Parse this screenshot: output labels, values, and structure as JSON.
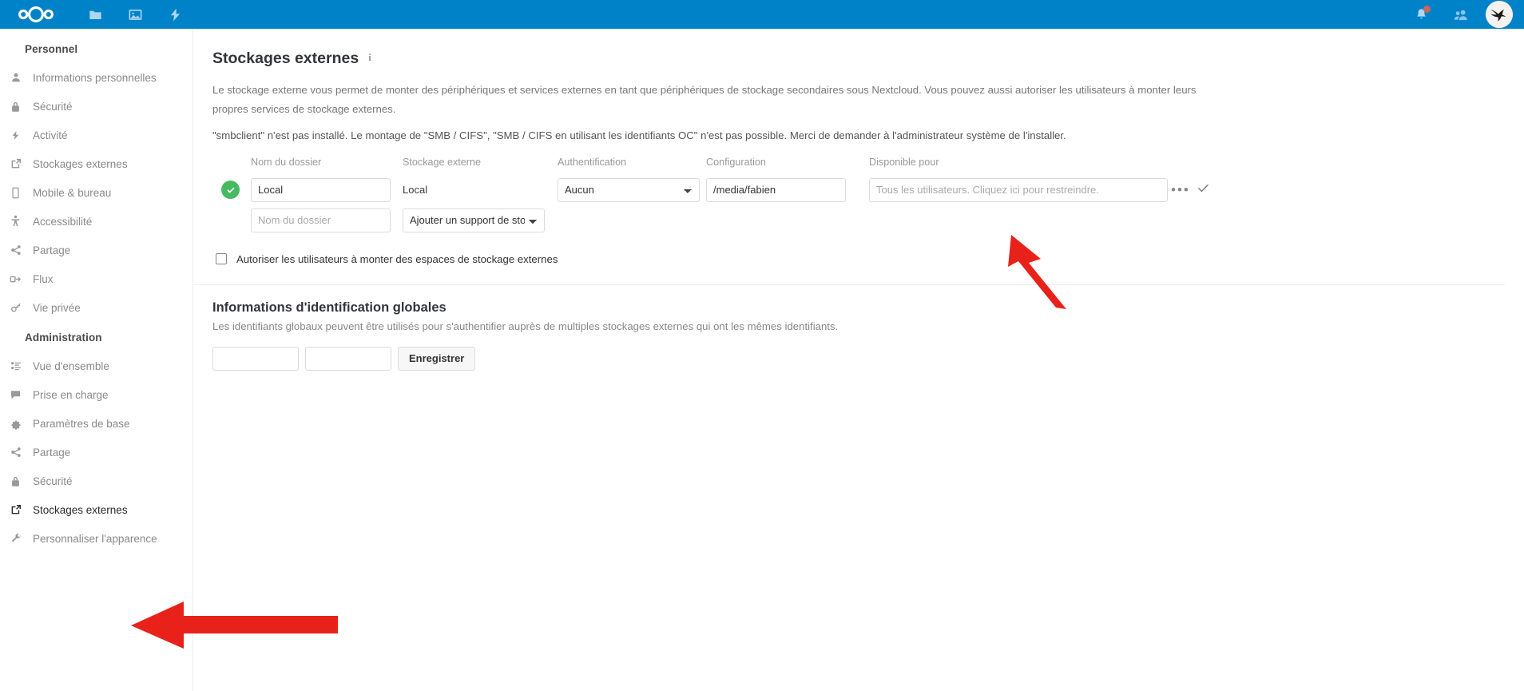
{
  "header": {
    "logo_name": "nextcloud-logo",
    "apps": [
      {
        "name": "files-app-icon",
        "label": "Fichiers"
      },
      {
        "name": "photos-app-icon",
        "label": "Photos"
      },
      {
        "name": "activity-app-icon",
        "label": "Activité"
      }
    ],
    "notifications_label": "Notifications",
    "contacts_label": "Contacts",
    "avatar_label": "Avatar utilisateur",
    "accent_color": "#0082c9",
    "badge_color": "#e9644a"
  },
  "sidebar": {
    "personal_section": "Personnel",
    "personal_items": [
      {
        "label": "Informations personnelles",
        "icon": "user-icon"
      },
      {
        "label": "Sécurité",
        "icon": "lock-icon"
      },
      {
        "label": "Activité",
        "icon": "bolt-icon"
      },
      {
        "label": "Stockages externes",
        "icon": "external-link-icon"
      },
      {
        "label": "Mobile & bureau",
        "icon": "mobile-icon"
      },
      {
        "label": "Accessibilité",
        "icon": "accessibility-icon"
      },
      {
        "label": "Partage",
        "icon": "share-icon"
      },
      {
        "label": "Flux",
        "icon": "feed-icon"
      },
      {
        "label": "Vie privée",
        "icon": "key-icon"
      }
    ],
    "admin_section": "Administration",
    "admin_items": [
      {
        "label": "Vue d'ensemble",
        "icon": "list-icon",
        "active": false
      },
      {
        "label": "Prise en charge",
        "icon": "speech-bubble-icon",
        "active": false
      },
      {
        "label": "Paramètres de base",
        "icon": "gear-icon",
        "active": false
      },
      {
        "label": "Partage",
        "icon": "share-icon",
        "active": false
      },
      {
        "label": "Sécurité",
        "icon": "lock-icon",
        "active": false
      },
      {
        "label": "Stockages externes",
        "icon": "external-link-icon",
        "active": true
      },
      {
        "label": "Personnaliser l'apparence",
        "icon": "wrench-icon",
        "active": false
      }
    ]
  },
  "main": {
    "title": "Stockages externes",
    "info_icon_label": "i",
    "description": "Le stockage externe vous permet de monter des périphériques et services externes en tant que périphériques de stockage secondaires sous Nextcloud. Vous pouvez aussi autoriser les utilisateurs à monter leurs propres services de stockage externes.",
    "warning": "\"smbclient\" n'est pas installé. Le montage de \"SMB / CIFS\", \"SMB / CIFS en utilisant les identifiants OC\" n'est pas possible. Merci de demander à l'administrateur système de l'installer.",
    "table": {
      "headers": {
        "folder_name": "Nom du dossier",
        "external_storage": "Stockage externe",
        "authentication": "Authentification",
        "configuration": "Configuration",
        "available_for": "Disponible pour"
      },
      "rows": [
        {
          "status": "ok",
          "folder_name": "Local",
          "external_storage": "Local",
          "authentication": "Aucun",
          "configuration": "/media/fabien",
          "available_for_placeholder": "Tous les utilisateurs. Cliquez ici pour restreindre.",
          "available_for_value": "",
          "menu_label": "•••",
          "save_label": "✓"
        }
      ],
      "new_row": {
        "folder_name_placeholder": "Nom du dossier",
        "backend_label": "Ajouter un support de stockage"
      }
    },
    "allow_user_mounts": {
      "label": "Autoriser les utilisateurs à monter des espaces de stockage externes",
      "checked": false
    },
    "global_credentials": {
      "title": "Informations d'identification globales",
      "description": "Les identifiants globaux peuvent être utilisés pour s'authentifier auprès de multiples stockages externes qui ont les mêmes identifiants.",
      "username_value": "",
      "password_value": "",
      "save_button": "Enregistrer"
    }
  },
  "annotations": {
    "arrow_color": "#e8221a",
    "arrow_config_target": "Configuration",
    "arrow_sidebar_target": "Stockages externes"
  }
}
